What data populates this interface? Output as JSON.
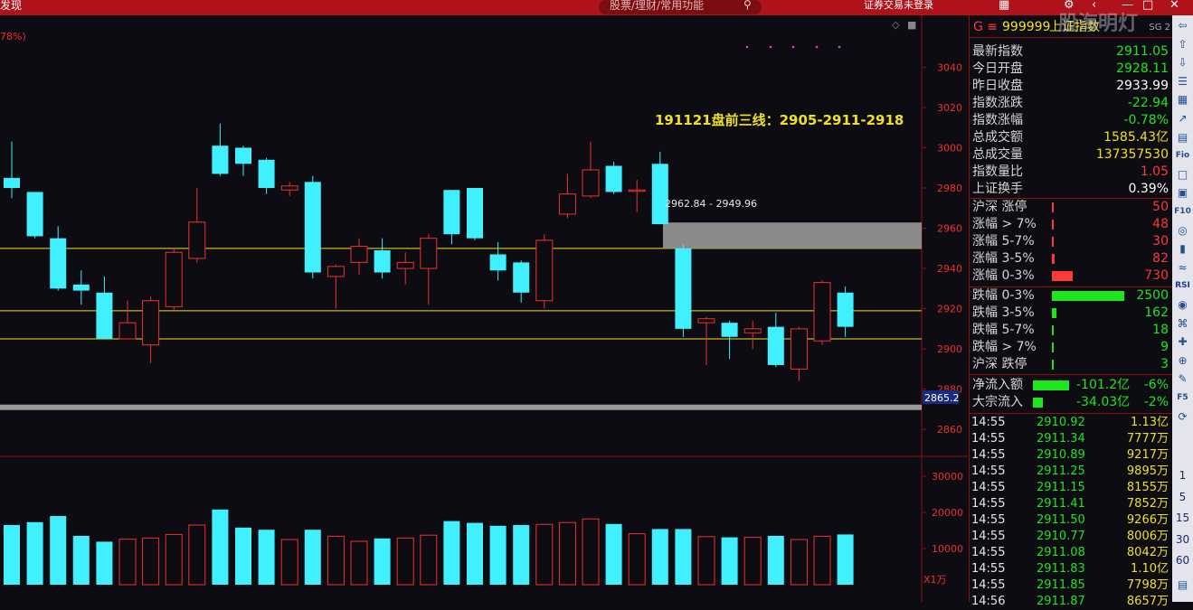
{
  "titlebar": {
    "left_text": "发现",
    "search_placeholder": "股票/理财/常用功能",
    "broker_status": "证券交易未登录"
  },
  "colors": {
    "up": "#f03030",
    "down": "#40f0ff",
    "gain": "#ff3838",
    "loss": "#1ee61e",
    "yellow": "#f0e020"
  },
  "chart": {
    "top_left_text": "78%)",
    "annotation": "191121盘前三线：2905-2911-2918",
    "zone_label": "2962.84 - 2949.96",
    "current_price_label": "2865.2",
    "price_axis_ticks": [
      "3040",
      "3020",
      "3000",
      "2980",
      "2960",
      "2940",
      "2920",
      "2900",
      "2880",
      "2860"
    ],
    "volume_axis_ticks": [
      "30000",
      "20000",
      "10000"
    ],
    "volume_unit": "X1万"
  },
  "chart_data": {
    "type": "candlestick",
    "ylim": [
      2852,
      3055
    ],
    "horizontal_lines": [
      2919,
      2905,
      2949.96
    ],
    "zone": [
      2949.96,
      2962.84
    ],
    "candles": [
      {
        "o": 2985,
        "c": 2980,
        "h": 3003,
        "l": 2975,
        "v": 16500
      },
      {
        "o": 2978,
        "c": 2956,
        "h": 2978,
        "l": 2955,
        "v": 17300
      },
      {
        "o": 2955,
        "c": 2930,
        "h": 2961,
        "l": 2929,
        "v": 19000
      },
      {
        "o": 2932,
        "c": 2929,
        "h": 2939,
        "l": 2922,
        "v": 13500
      },
      {
        "o": 2928,
        "c": 2905,
        "h": 2936,
        "l": 2905,
        "v": 11900
      },
      {
        "o": 2905,
        "c": 2913,
        "h": 2924,
        "l": 2905,
        "v": 12600
      },
      {
        "o": 2902,
        "c": 2924,
        "h": 2926,
        "l": 2893,
        "v": 12900
      },
      {
        "o": 2921,
        "c": 2948,
        "h": 2950,
        "l": 2919,
        "v": 13900
      },
      {
        "o": 2945,
        "c": 2963,
        "h": 2980,
        "l": 2943,
        "v": 16500
      },
      {
        "o": 3001,
        "c": 2987,
        "h": 3012,
        "l": 2986,
        "v": 20800
      },
      {
        "o": 3000,
        "c": 2992,
        "h": 3001,
        "l": 2986,
        "v": 15800
      },
      {
        "o": 2994,
        "c": 2980,
        "h": 2995,
        "l": 2977,
        "v": 15200
      },
      {
        "o": 2979,
        "c": 2981,
        "h": 2983,
        "l": 2976,
        "v": 12500
      },
      {
        "o": 2983,
        "c": 2938,
        "h": 2986,
        "l": 2935,
        "v": 15200
      },
      {
        "o": 2936,
        "c": 2941,
        "h": 2942,
        "l": 2920,
        "v": 13400
      },
      {
        "o": 2943,
        "c": 2951,
        "h": 2955,
        "l": 2937,
        "v": 12000
      },
      {
        "o": 2949,
        "c": 2938,
        "h": 2955,
        "l": 2935,
        "v": 12800
      },
      {
        "o": 2940,
        "c": 2943,
        "h": 2948,
        "l": 2932,
        "v": 12900
      },
      {
        "o": 2940,
        "c": 2955,
        "h": 2957,
        "l": 2922,
        "v": 13700
      },
      {
        "o": 2979,
        "c": 2957,
        "h": 2979,
        "l": 2952,
        "v": 17600
      },
      {
        "o": 2980,
        "c": 2955,
        "h": 2980,
        "l": 2954,
        "v": 17100
      },
      {
        "o": 2947,
        "c": 2939,
        "h": 2953,
        "l": 2934,
        "v": 16300
      },
      {
        "o": 2943,
        "c": 2928,
        "h": 2944,
        "l": 2923,
        "v": 16500
      },
      {
        "o": 2924,
        "c": 2954,
        "h": 2957,
        "l": 2920,
        "v": 16700
      },
      {
        "o": 2967,
        "c": 2977,
        "h": 2987,
        "l": 2965,
        "v": 17200
      },
      {
        "o": 2976,
        "c": 2989,
        "h": 3003,
        "l": 2975,
        "v": 18200
      },
      {
        "o": 2991,
        "c": 2978,
        "h": 2993,
        "l": 2977,
        "v": 16800
      },
      {
        "o": 2979,
        "c": 2979,
        "h": 2984,
        "l": 2968,
        "v": 14100
      },
      {
        "o": 2992,
        "c": 2962,
        "h": 2998,
        "l": 2962,
        "v": 15400
      },
      {
        "o": 2950,
        "c": 2910,
        "h": 2952,
        "l": 2906,
        "v": 15400
      },
      {
        "o": 2913,
        "c": 2915,
        "h": 2916,
        "l": 2892,
        "v": 13300
      },
      {
        "o": 2913,
        "c": 2906,
        "h": 2914,
        "l": 2895,
        "v": 13100
      },
      {
        "o": 2908,
        "c": 2910,
        "h": 2914,
        "l": 2900,
        "v": 13100
      },
      {
        "o": 2911,
        "c": 2892,
        "h": 2918,
        "l": 2891,
        "v": 13500
      },
      {
        "o": 2890,
        "c": 2910,
        "h": 2911,
        "l": 2884,
        "v": 12500
      },
      {
        "o": 2904,
        "c": 2933,
        "h": 2934,
        "l": 2902,
        "v": 13400
      },
      {
        "o": 2928,
        "c": 2911,
        "h": 2931,
        "l": 2906,
        "v": 13900
      }
    ]
  },
  "quote": {
    "header": {
      "code_prefix": "G ≡",
      "code": "999999",
      "name": "上证指数",
      "watermark": "股海明灯",
      "badge": "SG 2"
    },
    "rows": [
      {
        "label": "最新指数",
        "value": "2911.05",
        "color": "#1ee61e"
      },
      {
        "label": "今日开盘",
        "value": "2928.11",
        "color": "#1ee61e"
      },
      {
        "label": "昨日收盘",
        "value": "2933.99",
        "color": "#ffffff"
      },
      {
        "label": "指数涨跌",
        "value": "-22.94",
        "color": "#1ee61e"
      },
      {
        "label": "指数涨幅",
        "value": "-0.78%",
        "color": "#1ee61e"
      },
      {
        "label": "总成交额",
        "value": "1585.43亿",
        "color": "#f0e020"
      },
      {
        "label": "总成交量",
        "value": "137357530",
        "color": "#f0e020"
      },
      {
        "label": "指数量比",
        "value": "1.05",
        "color": "#ff3838"
      },
      {
        "label": "上证换手",
        "value": "0.39%",
        "color": "#ffffff"
      }
    ],
    "up_rows": [
      {
        "label": "沪深 涨停",
        "value": "50",
        "bar": 0.012
      },
      {
        "label": "涨幅 > 7%",
        "value": "48",
        "bar": 0.012
      },
      {
        "label": "涨幅 5-7%",
        "value": "30",
        "bar": 0.012
      },
      {
        "label": "涨幅 3-5%",
        "value": "82",
        "bar": 0.033
      },
      {
        "label": "涨幅 0-3%",
        "value": "730",
        "bar": 0.29
      }
    ],
    "down_rows": [
      {
        "label": "跌幅 0-3%",
        "value": "2500",
        "bar": 1.0
      },
      {
        "label": "跌幅 3-5%",
        "value": "162",
        "bar": 0.065
      },
      {
        "label": "跌幅 5-7%",
        "value": "18",
        "bar": 0.012
      },
      {
        "label": "跌幅 > 7%",
        "value": "9",
        "bar": 0.012
      },
      {
        "label": "沪深 跌停",
        "value": "3",
        "bar": 0.012
      }
    ],
    "flow_rows": [
      {
        "label": "净流入额",
        "value": "-101.2亿",
        "pct": "-6%",
        "bar": 0.72
      },
      {
        "label": "大宗流入",
        "value": "-34.03亿",
        "pct": "-2%",
        "bar": 0.2
      }
    ],
    "ticks": [
      {
        "time": "14:55",
        "price": "2910.92",
        "vol": "1.13亿"
      },
      {
        "time": "14:55",
        "price": "2911.34",
        "vol": "7777万"
      },
      {
        "time": "14:55",
        "price": "2910.89",
        "vol": "9217万"
      },
      {
        "time": "14:55",
        "price": "2911.25",
        "vol": "9895万"
      },
      {
        "time": "14:55",
        "price": "2911.15",
        "vol": "8155万"
      },
      {
        "time": "14:55",
        "price": "2911.41",
        "vol": "7852万"
      },
      {
        "time": "14:55",
        "price": "2911.50",
        "vol": "9266万"
      },
      {
        "time": "14:55",
        "price": "2910.77",
        "vol": "8006万"
      },
      {
        "time": "14:55",
        "price": "2911.08",
        "vol": "8042万"
      },
      {
        "time": "14:55",
        "price": "2911.83",
        "vol": "1.10亿"
      },
      {
        "time": "14:55",
        "price": "2911.85",
        "vol": "7798万"
      },
      {
        "time": "14:56",
        "price": "2911.87",
        "vol": "8657万"
      }
    ]
  },
  "toolbar": {
    "items": [
      "arrow-left-icon",
      "arrow-up-icon",
      "arrow-down-icon",
      "list-icon",
      "grid-icon",
      "chart-icon",
      "table-icon",
      "fio-icon",
      "doc-icon",
      "book-icon",
      "f10-icon",
      "target-icon",
      "candle-icon",
      "line-icon",
      "rsi-icon",
      "gift-icon",
      "network-icon",
      "cross-icon",
      "plus-icon",
      "pen-icon",
      "f5-icon",
      "refresh-icon"
    ],
    "labels": {
      "fio-icon": "Fio",
      "f10-icon": "F10",
      "rsi-icon": "RSI",
      "f5-icon": "F5"
    },
    "periods": [
      "1",
      "5",
      "15",
      "30",
      "60"
    ]
  }
}
